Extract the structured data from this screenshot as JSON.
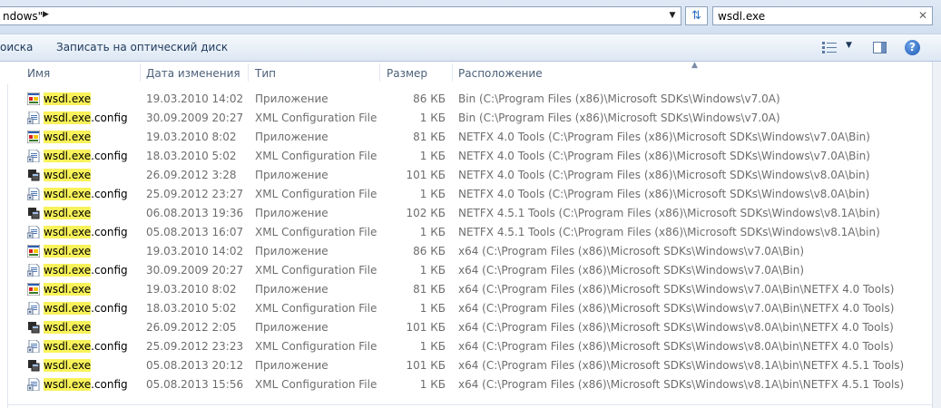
{
  "address_bar": {
    "path_text": "ndows\"",
    "search_value": "wsdl.exe"
  },
  "toolbar": {
    "search_label": "оиска",
    "burn_label": "Записать на оптический диск"
  },
  "columns": {
    "name": "Имя",
    "date": "Дата изменения",
    "type": "Тип",
    "size": "Размер",
    "location": "Расположение"
  },
  "icons": {
    "app_color": "app-color-icon",
    "app_console": "console-app-icon",
    "config": "config-file-icon"
  },
  "colors": {
    "highlight": "#f8f25a",
    "accent": "#2a6fbf"
  },
  "files": [
    {
      "icon": "app_color",
      "stem": "wsdl.exe",
      "ext": "",
      "date": "19.03.2010 14:02",
      "type": "Приложение",
      "size": "86 КБ",
      "location": "Bin (C:\\Program Files (x86)\\Microsoft SDKs\\Windows\\v7.0A)"
    },
    {
      "icon": "config",
      "stem": "wsdl.exe",
      "ext": ".config",
      "date": "30.09.2009 20:27",
      "type": "XML Configuration File",
      "size": "1 КБ",
      "location": "Bin (C:\\Program Files (x86)\\Microsoft SDKs\\Windows\\v7.0A)"
    },
    {
      "icon": "app_color",
      "stem": "wsdl.exe",
      "ext": "",
      "date": "19.03.2010 8:02",
      "type": "Приложение",
      "size": "81 КБ",
      "location": "NETFX 4.0 Tools (C:\\Program Files (x86)\\Microsoft SDKs\\Windows\\v7.0A\\Bin)"
    },
    {
      "icon": "config",
      "stem": "wsdl.exe",
      "ext": ".config",
      "date": "18.03.2010 5:02",
      "type": "XML Configuration File",
      "size": "1 КБ",
      "location": "NETFX 4.0 Tools (C:\\Program Files (x86)\\Microsoft SDKs\\Windows\\v7.0A\\Bin)"
    },
    {
      "icon": "app_console",
      "stem": "wsdl.exe",
      "ext": "",
      "date": "26.09.2012 3:28",
      "type": "Приложение",
      "size": "101 КБ",
      "location": "NETFX 4.0 Tools (C:\\Program Files (x86)\\Microsoft SDKs\\Windows\\v8.0A\\bin)"
    },
    {
      "icon": "config",
      "stem": "wsdl.exe",
      "ext": ".config",
      "date": "25.09.2012 23:27",
      "type": "XML Configuration File",
      "size": "1 КБ",
      "location": "NETFX 4.0 Tools (C:\\Program Files (x86)\\Microsoft SDKs\\Windows\\v8.0A\\bin)"
    },
    {
      "icon": "app_console",
      "stem": "wsdl.exe",
      "ext": "",
      "date": "06.08.2013 19:36",
      "type": "Приложение",
      "size": "102 КБ",
      "location": "NETFX 4.5.1 Tools (C:\\Program Files (x86)\\Microsoft SDKs\\Windows\\v8.1A\\bin)"
    },
    {
      "icon": "config",
      "stem": "wsdl.exe",
      "ext": ".config",
      "date": "05.08.2013 16:07",
      "type": "XML Configuration File",
      "size": "1 КБ",
      "location": "NETFX 4.5.1 Tools (C:\\Program Files (x86)\\Microsoft SDKs\\Windows\\v8.1A\\bin)"
    },
    {
      "icon": "app_color",
      "stem": "wsdl.exe",
      "ext": "",
      "date": "19.03.2010 14:02",
      "type": "Приложение",
      "size": "86 КБ",
      "location": "x64 (C:\\Program Files (x86)\\Microsoft SDKs\\Windows\\v7.0A\\Bin)"
    },
    {
      "icon": "config",
      "stem": "wsdl.exe",
      "ext": ".config",
      "date": "30.09.2009 20:27",
      "type": "XML Configuration File",
      "size": "1 КБ",
      "location": "x64 (C:\\Program Files (x86)\\Microsoft SDKs\\Windows\\v7.0A\\Bin)"
    },
    {
      "icon": "app_color",
      "stem": "wsdl.exe",
      "ext": "",
      "date": "19.03.2010 8:02",
      "type": "Приложение",
      "size": "81 КБ",
      "location": "x64 (C:\\Program Files (x86)\\Microsoft SDKs\\Windows\\v7.0A\\Bin\\NETFX 4.0 Tools)"
    },
    {
      "icon": "config",
      "stem": "wsdl.exe",
      "ext": ".config",
      "date": "18.03.2010 5:02",
      "type": "XML Configuration File",
      "size": "1 КБ",
      "location": "x64 (C:\\Program Files (x86)\\Microsoft SDKs\\Windows\\v7.0A\\Bin\\NETFX 4.0 Tools)"
    },
    {
      "icon": "app_console",
      "stem": "wsdl.exe",
      "ext": "",
      "date": "26.09.2012 2:05",
      "type": "Приложение",
      "size": "101 КБ",
      "location": "x64 (C:\\Program Files (x86)\\Microsoft SDKs\\Windows\\v8.0A\\bin\\NETFX 4.0 Tools)"
    },
    {
      "icon": "config",
      "stem": "wsdl.exe",
      "ext": ".config",
      "date": "25.09.2012 23:23",
      "type": "XML Configuration File",
      "size": "1 КБ",
      "location": "x64 (C:\\Program Files (x86)\\Microsoft SDKs\\Windows\\v8.0A\\bin\\NETFX 4.0 Tools)"
    },
    {
      "icon": "app_console",
      "stem": "wsdl.exe",
      "ext": "",
      "date": "05.08.2013 20:12",
      "type": "Приложение",
      "size": "101 КБ",
      "location": "x64 (C:\\Program Files (x86)\\Microsoft SDKs\\Windows\\v8.1A\\bin\\NETFX 4.5.1 Tools)"
    },
    {
      "icon": "config",
      "stem": "wsdl.exe",
      "ext": ".config",
      "date": "05.08.2013 15:56",
      "type": "XML Configuration File",
      "size": "1 КБ",
      "location": "x64 (C:\\Program Files (x86)\\Microsoft SDKs\\Windows\\v8.1A\\bin\\NETFX 4.5.1 Tools)"
    }
  ]
}
